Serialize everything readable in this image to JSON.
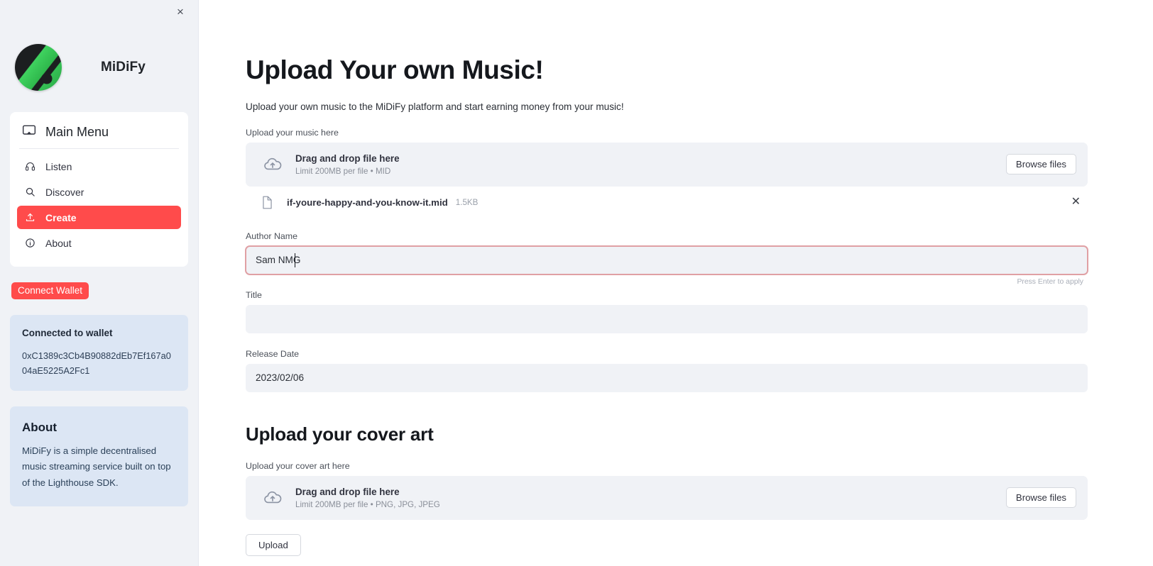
{
  "sidebar": {
    "close_label": "×",
    "brand_name": "MiDiFy",
    "menu_title": "Main Menu",
    "menu_items": [
      {
        "label": "Listen",
        "icon": "headphones-icon",
        "active": false
      },
      {
        "label": "Discover",
        "icon": "search-icon",
        "active": false
      },
      {
        "label": "Create",
        "icon": "upload-icon",
        "active": true
      },
      {
        "label": "About",
        "icon": "info-icon",
        "active": false
      }
    ],
    "connect_wallet_label": "Connect Wallet",
    "wallet": {
      "title": "Connected to wallet",
      "address": "0xC1389c3Cb4B90882dEb7Ef167a004aE5225A2Fc1"
    },
    "about": {
      "title": "About",
      "body": "MiDiFy is a simple decentralised music streaming service built on top of the Lighthouse SDK."
    }
  },
  "main": {
    "heading": "Upload Your own Music!",
    "subheading": "Upload your own music to the MiDiFy platform and start earning money from your music!",
    "music_upload": {
      "label": "Upload your music here",
      "drop_title": "Drag and drop file here",
      "drop_hint": "Limit 200MB per file • MID",
      "browse_label": "Browse files",
      "file_name": "if-youre-happy-and-you-know-it.mid",
      "file_size": "1.5KB",
      "file_remove_label": "✕"
    },
    "author": {
      "label": "Author Name",
      "value": "Sam NMG",
      "placeholder": "",
      "enter_hint": "Press Enter to apply"
    },
    "title_field": {
      "label": "Title",
      "value": "",
      "placeholder": ""
    },
    "release_date": {
      "label": "Release Date",
      "value": "2023/02/06"
    },
    "cover_art": {
      "heading": "Upload your cover art",
      "label": "Upload your cover art here",
      "drop_title": "Drag and drop file here",
      "drop_hint": "Limit 200MB per file • PNG, JPG, JPEG",
      "browse_label": "Browse files"
    },
    "upload_button_label": "Upload"
  },
  "colors": {
    "accent": "#ff4b4b",
    "sidebar_bg": "#f0f2f6",
    "info_card_bg": "#dce6f4",
    "input_bg": "#f0f2f6",
    "focus_border": "#e0a0a4"
  }
}
